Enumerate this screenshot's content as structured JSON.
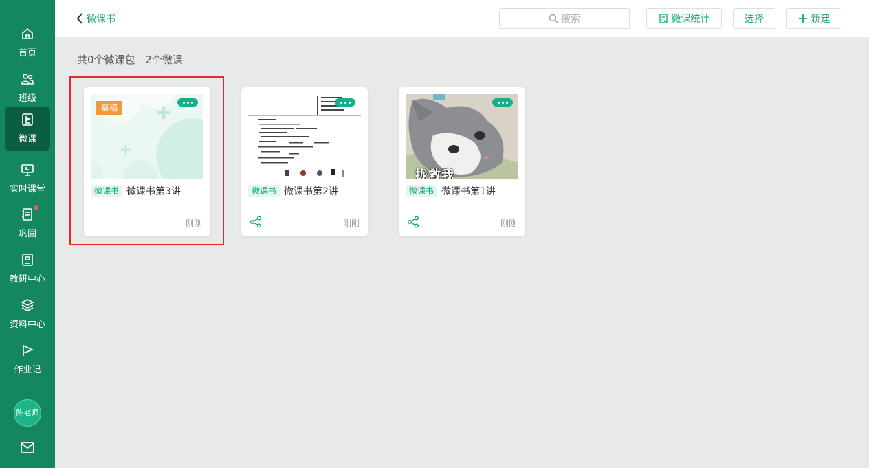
{
  "sidebar": {
    "items": [
      {
        "label": "首页",
        "icon": "home-icon"
      },
      {
        "label": "班级",
        "icon": "people-icon"
      },
      {
        "label": "微课",
        "icon": "play-doc-icon",
        "active": true
      },
      {
        "label": "实时课堂",
        "icon": "board-icon"
      },
      {
        "label": "巩固",
        "icon": "notebook-icon",
        "badge_dot": true
      },
      {
        "label": "教研中心",
        "icon": "book-icon"
      },
      {
        "label": "资料中心",
        "icon": "layers-icon"
      },
      {
        "label": "作业记",
        "icon": "flag-icon"
      }
    ],
    "avatar_label": "陈老师",
    "mail_icon": "mail-icon"
  },
  "topbar": {
    "back_label": "微课书",
    "search_placeholder": "搜索",
    "stats_label": "微课统计",
    "select_label": "选择",
    "new_label": "新建"
  },
  "summary": {
    "packages": "共0个微课包",
    "lessons": "2个微课"
  },
  "cards": [
    {
      "title": "微课书第3讲",
      "tag": "微课书",
      "time": "刚刚",
      "draft_label": "草稿",
      "thumbnail": "mint-placeholder"
    },
    {
      "title": "微课书第2讲",
      "tag": "微课书",
      "time": "刚刚",
      "thumbnail": "worksheet-document"
    },
    {
      "title": "微课书第1讲",
      "tag": "微课书",
      "time": "刚刚",
      "thumbnail": "grey-cat-photo",
      "thumbnail_caption": "拢救我"
    }
  ],
  "colors": {
    "sidebar": "#14875f",
    "sidebar_active": "#0b5e40",
    "accent": "#14a77a",
    "draft": "#f29a3a",
    "highlight": "#e8262e"
  }
}
